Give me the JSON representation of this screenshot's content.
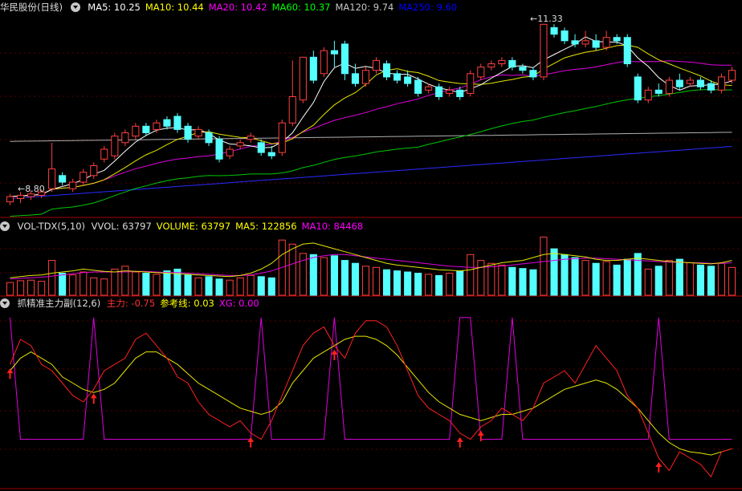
{
  "price_panel": {
    "title": "华民股份(日线)",
    "ma": [
      {
        "label": "MA5: 10.25",
        "color": "#ffffff"
      },
      {
        "label": "MA10: 10.44",
        "color": "#ffff00"
      },
      {
        "label": "MA20: 10.42",
        "color": "#ff00ff"
      },
      {
        "label": "MA60: 10.37",
        "color": "#00ff00"
      },
      {
        "label": "MA120: 9.74",
        "color": "#c8c8c8"
      },
      {
        "label": "MA250: 9.60",
        "color": "#0000ff"
      }
    ],
    "high_label": "11.33",
    "low_label": "8.80"
  },
  "volume_panel": {
    "title": "VOL-TDX(5,10)",
    "items": [
      {
        "label": "VVOL: 63797",
        "color": "#dddddd"
      },
      {
        "label": "VOLUME: 63797",
        "color": "#ffff00"
      },
      {
        "label": "MA5: 122856",
        "color": "#ffff00"
      },
      {
        "label": "MA10: 84468",
        "color": "#ff00ff"
      }
    ]
  },
  "indicator_panel": {
    "title": "抓精准主力副(12,6)",
    "items": [
      {
        "label": "主力: -0.75",
        "color": "#ff3030"
      },
      {
        "label": "参考线: 0.03",
        "color": "#ffff00"
      },
      {
        "label": "XG: 0.00",
        "color": "#ff00ff"
      }
    ]
  },
  "chart_data": {
    "type": "candlestick",
    "candles": [
      [
        8.9,
        8.98,
        8.85,
        9.02
      ],
      [
        8.95,
        9.0,
        8.88,
        9.05
      ],
      [
        8.98,
        9.02,
        8.93,
        9.07
      ],
      [
        9.0,
        9.05,
        8.96,
        9.09
      ],
      [
        9.1,
        9.4,
        9.05,
        9.8
      ],
      [
        9.3,
        9.2,
        9.15,
        9.35
      ],
      [
        9.1,
        9.2,
        9.05,
        9.25
      ],
      [
        9.2,
        9.35,
        9.15,
        9.4
      ],
      [
        9.3,
        9.45,
        9.25,
        9.5
      ],
      [
        9.55,
        9.7,
        9.5,
        9.75
      ],
      [
        9.6,
        9.9,
        9.55,
        9.95
      ],
      [
        9.8,
        9.95,
        9.75,
        10.0
      ],
      [
        9.9,
        10.05,
        9.85,
        10.1
      ],
      [
        10.05,
        9.95,
        9.9,
        10.1
      ],
      [
        10.0,
        10.1,
        9.95,
        10.15
      ],
      [
        10.15,
        10.05,
        10.0,
        10.2
      ],
      [
        10.2,
        10.0,
        9.95,
        10.25
      ],
      [
        10.05,
        9.85,
        9.8,
        10.1
      ],
      [
        9.9,
        10.0,
        9.85,
        10.05
      ],
      [
        9.95,
        9.8,
        9.75,
        10.0
      ],
      [
        9.85,
        9.55,
        9.5,
        9.9
      ],
      [
        9.6,
        9.7,
        9.55,
        9.75
      ],
      [
        9.75,
        9.8,
        9.7,
        9.85
      ],
      [
        9.85,
        9.9,
        9.8,
        9.95
      ],
      [
        9.8,
        9.65,
        9.6,
        9.85
      ],
      [
        9.65,
        9.6,
        9.55,
        9.75
      ],
      [
        9.65,
        10.1,
        9.6,
        10.15
      ],
      [
        10.1,
        10.5,
        10.05,
        11.05
      ],
      [
        10.45,
        11.1,
        10.4,
        11.1
      ],
      [
        11.1,
        10.75,
        10.7,
        11.2
      ],
      [
        10.85,
        11.2,
        10.8,
        11.25
      ],
      [
        11.2,
        11.15,
        10.95,
        11.35
      ],
      [
        11.3,
        10.85,
        10.75,
        11.35
      ],
      [
        10.85,
        10.7,
        10.65,
        11.0
      ],
      [
        10.7,
        10.9,
        10.65,
        10.95
      ],
      [
        10.9,
        11.05,
        10.85,
        11.1
      ],
      [
        11.0,
        10.8,
        10.75,
        11.05
      ],
      [
        10.85,
        10.75,
        10.7,
        10.9
      ],
      [
        10.8,
        10.7,
        10.65,
        10.9
      ],
      [
        10.75,
        10.55,
        10.5,
        10.8
      ],
      [
        10.6,
        10.65,
        10.55,
        10.7
      ],
      [
        10.65,
        10.5,
        10.45,
        10.7
      ],
      [
        10.55,
        10.6,
        10.5,
        10.65
      ],
      [
        10.6,
        10.5,
        10.45,
        10.65
      ],
      [
        10.55,
        10.85,
        10.5,
        10.9
      ],
      [
        10.8,
        10.95,
        10.75,
        11.0
      ],
      [
        10.95,
        11.0,
        10.9,
        11.05
      ],
      [
        11.0,
        11.05,
        10.95,
        11.1
      ],
      [
        11.05,
        10.95,
        10.9,
        11.1
      ],
      [
        10.95,
        10.9,
        10.85,
        11.0
      ],
      [
        10.9,
        10.8,
        10.75,
        10.95
      ],
      [
        10.8,
        11.6,
        10.75,
        11.6
      ],
      [
        11.55,
        11.45,
        11.4,
        11.6
      ],
      [
        11.5,
        11.35,
        11.3,
        11.55
      ],
      [
        11.35,
        11.3,
        11.25,
        11.45
      ],
      [
        11.3,
        11.35,
        11.25,
        11.5
      ],
      [
        11.35,
        11.25,
        11.2,
        11.45
      ],
      [
        11.25,
        11.4,
        11.2,
        11.5
      ],
      [
        11.4,
        11.35,
        11.3,
        11.45
      ],
      [
        11.4,
        11.0,
        10.95,
        11.45
      ],
      [
        10.8,
        10.45,
        10.4,
        10.85
      ],
      [
        10.45,
        10.6,
        10.4,
        10.65
      ],
      [
        10.6,
        10.55,
        10.5,
        10.7
      ],
      [
        10.55,
        10.75,
        10.5,
        10.8
      ],
      [
        10.75,
        10.65,
        10.6,
        10.85
      ],
      [
        10.7,
        10.75,
        10.65,
        10.8
      ],
      [
        10.75,
        10.65,
        10.6,
        10.8
      ],
      [
        10.7,
        10.6,
        10.55,
        10.75
      ],
      [
        10.6,
        10.8,
        10.55,
        10.85
      ],
      [
        10.75,
        10.9,
        10.7,
        10.95
      ]
    ],
    "volume": [
      22,
      25,
      26,
      24,
      60,
      38,
      35,
      40,
      30,
      28,
      45,
      50,
      40,
      38,
      36,
      42,
      45,
      35,
      30,
      32,
      28,
      26,
      30,
      34,
      32,
      30,
      95,
      88,
      72,
      70,
      65,
      68,
      60,
      55,
      50,
      48,
      44,
      42,
      40,
      38,
      36,
      34,
      38,
      42,
      70,
      60,
      55,
      52,
      48,
      46,
      44,
      100,
      80,
      70,
      65,
      60,
      55,
      58,
      52,
      62,
      72,
      45,
      50,
      60,
      62,
      56,
      52,
      50,
      55,
      48
    ],
    "ma5_vol": [
      30,
      32,
      34,
      35,
      38,
      40,
      42,
      45,
      43,
      41,
      40,
      42,
      41,
      40,
      39,
      38,
      37,
      36,
      35,
      34,
      33,
      32,
      34,
      38,
      45,
      55,
      70,
      80,
      88,
      90,
      85,
      80,
      75,
      70,
      65,
      60,
      55,
      52,
      50,
      48,
      46,
      44,
      43,
      42,
      44,
      48,
      52,
      56,
      58,
      60,
      65,
      70,
      72,
      70,
      68,
      66,
      62,
      60,
      60,
      62,
      64,
      62,
      60,
      58,
      57,
      56,
      55,
      54,
      56,
      60
    ],
    "ma10_vol": [
      28,
      29,
      30,
      31,
      33,
      35,
      37,
      39,
      40,
      40,
      40,
      40,
      41,
      41,
      40,
      39,
      39,
      38,
      37,
      36,
      35,
      34,
      34,
      35,
      38,
      42,
      48,
      54,
      60,
      65,
      68,
      70,
      70,
      68,
      66,
      64,
      62,
      60,
      58,
      56,
      54,
      52,
      50,
      49,
      48,
      48,
      49,
      50,
      52,
      54,
      56,
      58,
      60,
      62,
      63,
      64,
      64,
      63,
      62,
      61,
      60,
      59,
      58,
      57,
      57,
      56,
      56,
      55,
      55,
      56
    ],
    "zhuli": [
      0.6,
      1.0,
      0.9,
      0.6,
      0.5,
      0.3,
      0.1,
      0.0,
      0.2,
      0.5,
      0.6,
      0.7,
      1.0,
      1.1,
      0.9,
      0.7,
      0.4,
      0.3,
      0.0,
      -0.2,
      -0.3,
      -0.4,
      -0.3,
      -0.5,
      -0.6,
      -0.3,
      0.1,
      0.5,
      0.9,
      1.1,
      1.2,
      0.9,
      0.7,
      1.1,
      1.3,
      1.3,
      1.2,
      0.9,
      0.5,
      0.1,
      -0.1,
      -0.2,
      -0.3,
      -0.5,
      -0.6,
      -0.4,
      -0.3,
      -0.1,
      -0.2,
      -0.3,
      -0.1,
      0.3,
      0.4,
      0.5,
      0.3,
      0.6,
      0.9,
      0.7,
      0.5,
      0.1,
      -0.1,
      -0.5,
      -0.9,
      -1.1,
      -0.8,
      -0.9,
      -1.0,
      -1.2,
      -0.8,
      -0.75
    ],
    "cankao": [
      0.5,
      0.7,
      0.8,
      0.7,
      0.6,
      0.4,
      0.3,
      0.2,
      0.15,
      0.2,
      0.3,
      0.5,
      0.7,
      0.8,
      0.8,
      0.7,
      0.6,
      0.45,
      0.3,
      0.2,
      0.1,
      0.0,
      -0.1,
      -0.15,
      -0.2,
      -0.15,
      0.0,
      0.3,
      0.5,
      0.7,
      0.8,
      0.9,
      1.0,
      1.05,
      1.05,
      1.0,
      0.9,
      0.75,
      0.55,
      0.35,
      0.15,
      0.0,
      -0.1,
      -0.2,
      -0.25,
      -0.3,
      -0.25,
      -0.2,
      -0.2,
      -0.15,
      -0.1,
      0.0,
      0.1,
      0.2,
      0.25,
      0.3,
      0.35,
      0.3,
      0.2,
      0.05,
      -0.1,
      -0.3,
      -0.5,
      -0.65,
      -0.75,
      -0.8,
      -0.82,
      -0.85,
      -0.8,
      -0.75
    ],
    "xg_peaks": [
      0,
      8,
      24,
      31,
      43,
      44,
      48,
      62
    ],
    "buy_arrows": [
      0,
      8,
      23,
      31,
      43,
      45,
      62
    ],
    "price_range": [
      8.7,
      11.75
    ],
    "volume_max": 105,
    "indicator_range": [
      -1.35,
      1.45
    ]
  }
}
